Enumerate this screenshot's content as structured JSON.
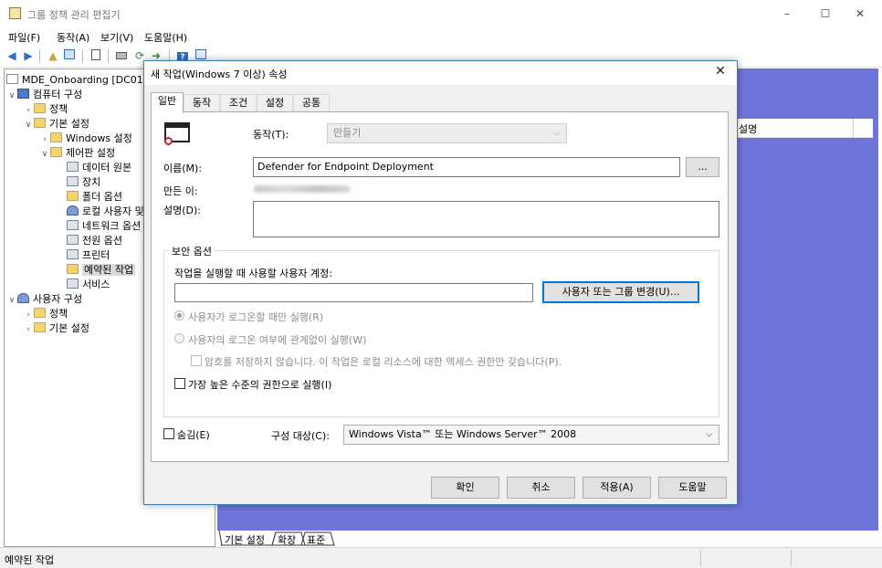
{
  "window": {
    "title": "그룹 정책 관리 편집기",
    "controls": {
      "minimize": "–",
      "maximize": "☐",
      "close": "✕"
    }
  },
  "menu": [
    "파일(F)",
    "동작(A)",
    "보기(V)",
    "도움말(H)"
  ],
  "tree": {
    "items": [
      {
        "label": "MDE_Onboarding [DC01.TV"
      },
      {
        "label": "컴퓨터 구성",
        "expander": "∨"
      },
      {
        "label": "정책",
        "expander": "›"
      },
      {
        "label": "기본 설정",
        "expander": "∨"
      },
      {
        "label": "Windows 설정",
        "expander": "›"
      },
      {
        "label": "제어판 설정",
        "expander": "∨"
      },
      {
        "label": "데이터 원본"
      },
      {
        "label": "장치"
      },
      {
        "label": "폴더 옵션"
      },
      {
        "label": "로컬 사용자 및"
      },
      {
        "label": "네트워크 옵션"
      },
      {
        "label": "전원 옵션"
      },
      {
        "label": "프린터"
      },
      {
        "label": "예약된 작업"
      },
      {
        "label": "서비스"
      },
      {
        "label": "사용자 구성",
        "expander": "∨"
      },
      {
        "label": "정책",
        "expander": "›"
      },
      {
        "label": "기본 설정",
        "expander": "›"
      }
    ]
  },
  "right_pane": {
    "column_header": "설명",
    "bottom_tabs": [
      "기본 설정",
      "확장",
      "표준"
    ]
  },
  "statusbar": {
    "text": "예약된 작업"
  },
  "dialog": {
    "title": "새 작업(Windows 7 이상) 속성",
    "close": "✕",
    "tabs": [
      "일반",
      "동작",
      "조건",
      "설정",
      "공통"
    ],
    "action_label": "동작(T):",
    "action_value": "만들기",
    "name_label": "이름(M):",
    "name_value": "Defender for Endpoint Deployment",
    "browse_label": "...",
    "author_label": "만든 이:",
    "description_label": "설명(D):",
    "description_value": "",
    "security_group_title": "보안 옵션",
    "run_as_label": "작업을 실행할 때 사용할 사용자 계정:",
    "run_as_value": "",
    "change_user_button": "사용자 또는 그룹 변경(U)...",
    "radio_logged_on": "사용자가 로그온할 때만 실행(R)",
    "radio_whether": "사용자의 로그온 여부에 관계없이 실행(W)",
    "no_store_password": "암호를 저장하지 않습니다. 이 작업은 로컬 리소스에 대한 액세스 권한만 갖습니다(P).",
    "highest_privileges": "가장 높은 수준의 권한으로 실행(I)",
    "hidden_label": "숨김(E)",
    "configure_for_label": "구성 대상(C):",
    "configure_for_value": "Windows Vista™ 또는 Windows Server™ 2008",
    "buttons": {
      "ok": "확인",
      "cancel": "취소",
      "apply": "적용(A)",
      "help": "도움말"
    }
  },
  "colors": {
    "right_pane_bg": "#6e74d8",
    "dialog_border": "#3c7fb1",
    "focus_blue": "#0078d7"
  }
}
